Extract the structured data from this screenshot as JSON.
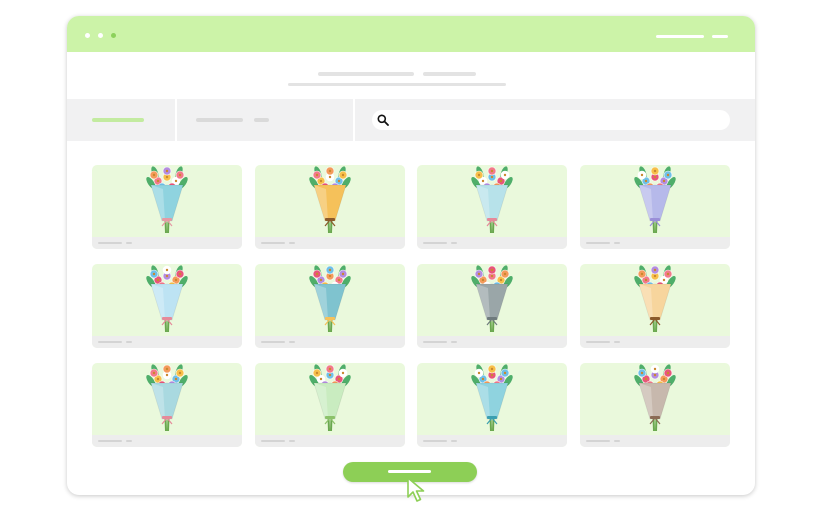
{
  "colors": {
    "accent": "#8dcf56",
    "titlebar": "#ccf3a8",
    "card_bg": "#eaf9dc",
    "placeholder": "#e3e3e3"
  },
  "search": {
    "icon": "search-icon",
    "value": ""
  },
  "tabs": [
    {
      "name": "tab-active",
      "active": true
    },
    {
      "name": "tab-second",
      "active": false
    }
  ],
  "products": [
    {
      "row": 1,
      "col": 1,
      "wrap": "#8fd3df",
      "tie": "#e59aa4"
    },
    {
      "row": 1,
      "col": 2,
      "wrap": "#f5c15a",
      "tie": "#8b5a2b"
    },
    {
      "row": 1,
      "col": 3,
      "wrap": "#b7e2ea",
      "tie": "#e58a9a"
    },
    {
      "row": 1,
      "col": 4,
      "wrap": "#b6b9ea",
      "tie": "#9a8fd8"
    },
    {
      "row": 2,
      "col": 1,
      "wrap": "#bde3f3",
      "tie": "#e58a9a"
    },
    {
      "row": 2,
      "col": 2,
      "wrap": "#7fc3cf",
      "tie": "#f5c15a"
    },
    {
      "row": 2,
      "col": 3,
      "wrap": "#9aa6a8",
      "tie": "#6f7b7d"
    },
    {
      "row": 2,
      "col": 4,
      "wrap": "#f7d59d",
      "tie": "#8b5a2b"
    },
    {
      "row": 3,
      "col": 1,
      "wrap": "#a9d9e0",
      "tie": "#e58a9a"
    },
    {
      "row": 3,
      "col": 2,
      "wrap": "#c9ecc0",
      "tie": "#8cc26a"
    },
    {
      "row": 3,
      "col": 3,
      "wrap": "#8fd3df",
      "tie": "#3b9fb0"
    },
    {
      "row": 3,
      "col": 4,
      "wrap": "#c7b8ad",
      "tie": "#8b6b55"
    }
  ],
  "cursor": {
    "icon": "cursor-arrow-icon"
  }
}
